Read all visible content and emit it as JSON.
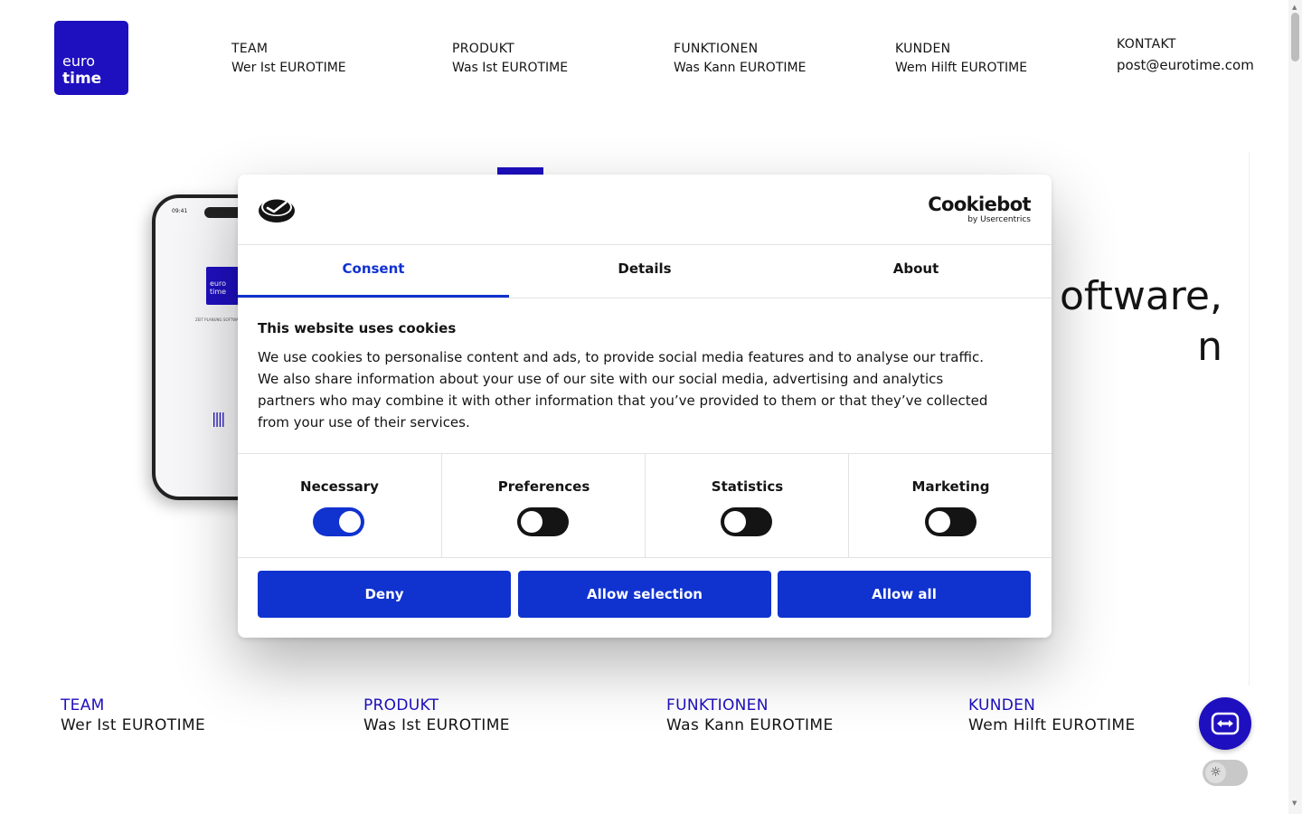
{
  "header": {
    "logo": {
      "line1": "euro",
      "line2": "time"
    },
    "nav": [
      {
        "caption": "TEAM",
        "sub": "Wer Ist EUROTIME"
      },
      {
        "caption": "PRODUKT",
        "sub": "Was Ist EUROTIME"
      },
      {
        "caption": "FUNKTIONEN",
        "sub": "Was Kann EUROTIME"
      },
      {
        "caption": "KUNDEN",
        "sub": "Wem Hilft EUROTIME"
      }
    ],
    "contact": {
      "caption": "KONTAKT",
      "sub": "post@eurotime.com"
    }
  },
  "hero": {
    "line1": "oftware,",
    "line2": "n",
    "phone": {
      "time": "09:41",
      "logo_line1": "euro",
      "logo_line2": "time",
      "tagline": "ZEIT PLANUNG SOFTWARE",
      "bars": "||||"
    }
  },
  "footer_nav": [
    {
      "caption": "TEAM",
      "sub": "Wer Ist EUROTIME"
    },
    {
      "caption": "PRODUKT",
      "sub": "Was Ist EUROTIME"
    },
    {
      "caption": "FUNKTIONEN",
      "sub": "Was Kann EUROTIME"
    },
    {
      "caption": "KUNDEN",
      "sub": "Wem Hilft EUROTIME"
    }
  ],
  "cookie_dialog": {
    "brand": {
      "name": "Cookiebot",
      "by": "by Usercentrics"
    },
    "tabs": [
      "Consent",
      "Details",
      "About"
    ],
    "active_tab": "Consent",
    "title": "This website uses cookies",
    "body": "We use cookies to personalise content and ads, to provide social media features and to analyse our traffic. We also share information about your use of our site with our social media, advertising and analytics partners who may combine it with other information that you’ve provided to them or that they’ve collected from your use of their services.",
    "categories": [
      {
        "label": "Necessary",
        "on": true
      },
      {
        "label": "Preferences",
        "on": false
      },
      {
        "label": "Statistics",
        "on": false
      },
      {
        "label": "Marketing",
        "on": false
      }
    ],
    "buttons": {
      "deny": "Deny",
      "allow_selection": "Allow selection",
      "allow_all": "Allow all"
    }
  },
  "colors": {
    "brand": "#1e0fbf",
    "accent": "#1032cf",
    "text": "#141414"
  },
  "icons": {
    "teamviewer": "teamviewer-icon",
    "theme": "sun-icon",
    "cookiebot": "cookie-icon"
  }
}
